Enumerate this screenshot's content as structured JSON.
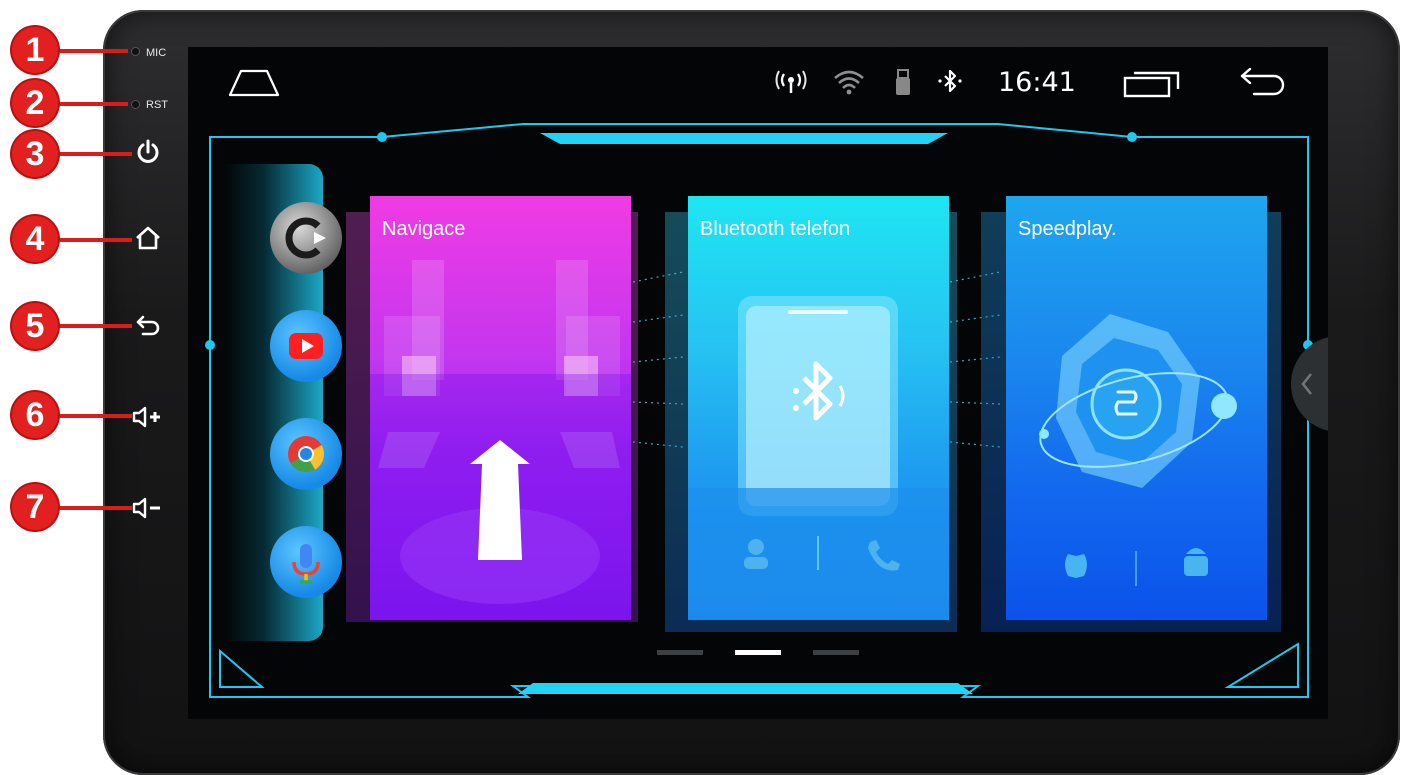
{
  "hardware": {
    "mic_label": "MIC",
    "rst_label": "RST",
    "markers": [
      "1",
      "2",
      "3",
      "4",
      "5",
      "6",
      "7"
    ],
    "icons": [
      "mic-hole",
      "reset-hole",
      "power-icon",
      "home-icon",
      "back-icon",
      "volume-up-icon",
      "volume-down-icon"
    ]
  },
  "statusbar": {
    "time": "16:41",
    "icons": [
      "home-icon",
      "hotspot-icon",
      "wifi-icon",
      "usb-icon",
      "bluetooth-icon",
      "recent-apps-icon",
      "back-icon"
    ]
  },
  "dock": {
    "apps": [
      {
        "name": "carplay-app",
        "icon": "carplay-icon"
      },
      {
        "name": "youtube-app",
        "icon": "youtube-icon"
      },
      {
        "name": "chrome-app",
        "icon": "chrome-icon"
      },
      {
        "name": "voice-assistant-app",
        "icon": "microphone-icon"
      }
    ]
  },
  "cards": [
    {
      "title": "Navigace",
      "icon": "navigation-arrow-icon"
    },
    {
      "title": "Bluetooth telefon",
      "icon": "bluetooth-phone-icon"
    },
    {
      "title": "Speedplay.",
      "icon": "speedplay-icon"
    }
  ],
  "pager": {
    "count": 3,
    "active": 2
  },
  "colors": {
    "accent": "#1ec8ee",
    "nav_card": "#b62cf2",
    "bt_card": "#1aa4f4",
    "sp_card": "#0f6cf0",
    "marker": "#e32020"
  }
}
